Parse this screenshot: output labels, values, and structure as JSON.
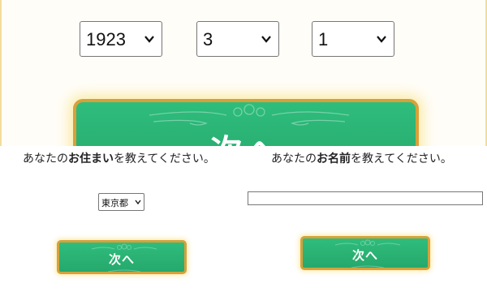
{
  "birthdate": {
    "year": "1923",
    "month": "3",
    "day": "1"
  },
  "top_next_label": "次へ",
  "address_step": {
    "question_before": "あなたの",
    "question_emphasis": "お住まい",
    "question_after": "を教えてください。",
    "prefecture_value": "東京都",
    "next_label": "次へ"
  },
  "name_step": {
    "question_before": "あなたの",
    "question_emphasis": "お名前",
    "question_after": "を教えてください。",
    "name_value": "",
    "next_label": "次へ"
  },
  "colors": {
    "button_green": "#2ebd7c",
    "button_border_gold": "#d7a13a"
  }
}
